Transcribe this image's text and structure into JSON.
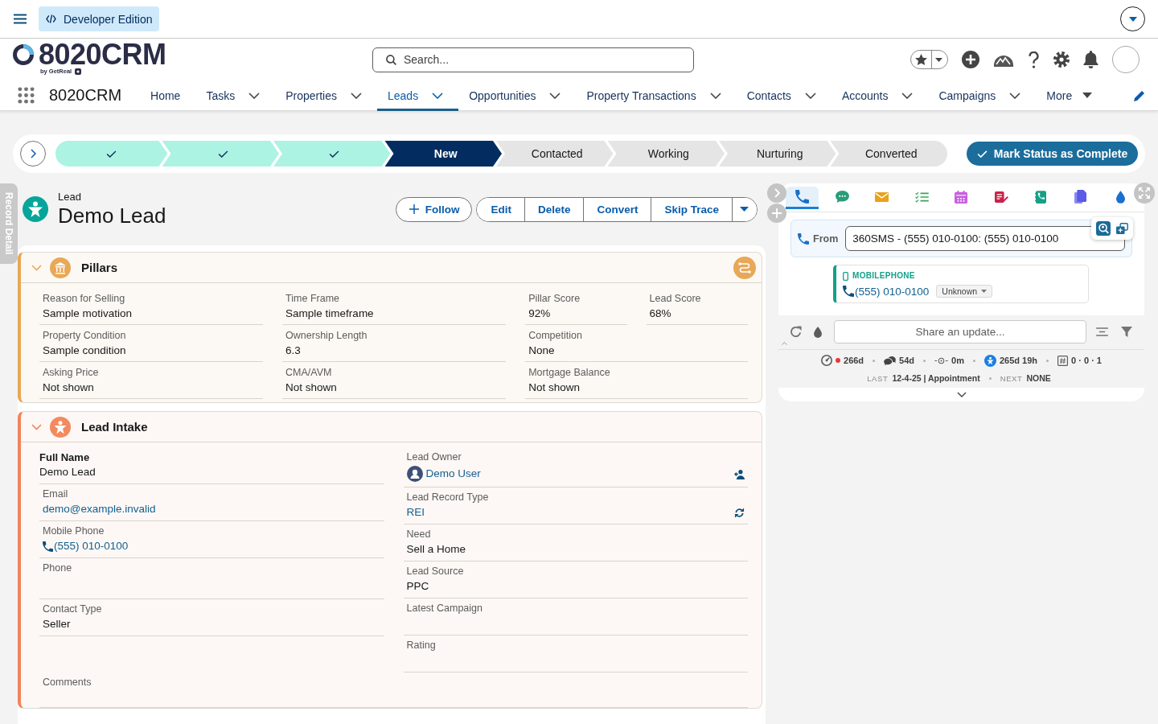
{
  "top_bar": {
    "badge": "Developer Edition"
  },
  "logo": {
    "name": "8020CRM",
    "tagline": "by GetReal"
  },
  "search": {
    "placeholder": "Search..."
  },
  "nav": {
    "app_name": "8020CRM",
    "items": [
      {
        "label": "Home",
        "menu": false,
        "selected": false
      },
      {
        "label": "Tasks",
        "menu": true,
        "selected": false
      },
      {
        "label": "Properties",
        "menu": true,
        "selected": false
      },
      {
        "label": "Leads",
        "menu": true,
        "selected": true
      },
      {
        "label": "Opportunities",
        "menu": true,
        "selected": false
      },
      {
        "label": "Property Transactions",
        "menu": true,
        "selected": false
      },
      {
        "label": "Contacts",
        "menu": true,
        "selected": false
      },
      {
        "label": "Accounts",
        "menu": true,
        "selected": false
      },
      {
        "label": "Campaigns",
        "menu": true,
        "selected": false
      }
    ],
    "more": "More"
  },
  "path": {
    "stages": [
      {
        "complete": true,
        "selected": false
      },
      {
        "complete": true,
        "selected": false
      },
      {
        "complete": true,
        "selected": false
      },
      {
        "label": "New",
        "complete": false,
        "selected": true
      },
      {
        "label": "Contacted",
        "complete": false,
        "selected": false
      },
      {
        "label": "Working",
        "complete": false,
        "selected": false
      },
      {
        "label": "Nurturing",
        "complete": false,
        "selected": false
      },
      {
        "label": "Converted",
        "complete": false,
        "selected": false
      }
    ],
    "action": "Mark Status as Complete"
  },
  "side_tab": "Record Detail",
  "record": {
    "object": "Lead",
    "title": "Demo Lead",
    "follow": "Follow",
    "actions": [
      "Edit",
      "Delete",
      "Convert",
      "Skip Trace"
    ]
  },
  "pillars": {
    "title": "Pillars",
    "expanded": true,
    "rows": [
      [
        {
          "label": "Reason for Selling",
          "value": "Sample motivation"
        },
        {
          "label": "Time Frame",
          "value": "Sample timeframe"
        },
        {
          "label": "Pillar Score",
          "value": "92%"
        },
        {
          "label": "Lead Score",
          "value": "68%"
        }
      ],
      [
        {
          "label": "Property Condition",
          "value": "Sample condition"
        },
        {
          "label": "Ownership Length",
          "value": "6.3"
        },
        {
          "label": "Competition",
          "value": "None"
        }
      ],
      [
        {
          "label": "Asking Price",
          "value": "Not shown"
        },
        {
          "label": "CMA/AVM",
          "value": "Not shown"
        },
        {
          "label": "Mortgage Balance",
          "value": "Not shown"
        }
      ]
    ]
  },
  "lead_intake": {
    "title": "Lead Intake",
    "expanded": true,
    "left": [
      {
        "kind": "name",
        "label": "Full Name",
        "value": "Demo Lead"
      },
      {
        "kind": "email",
        "label": "Email",
        "value": "demo@example.invalid"
      },
      {
        "kind": "phone",
        "label": "Mobile Phone",
        "value": "(555) 010-0100"
      },
      {
        "kind": "text",
        "label": "Phone"
      },
      {
        "kind": "text",
        "label": "Contact Type",
        "value": "Seller"
      }
    ],
    "right": [
      {
        "kind": "owner",
        "label": "Lead Owner",
        "value": "Demo User"
      },
      {
        "kind": "record_type",
        "label": "Lead Record Type",
        "value": "REI"
      },
      {
        "kind": "text",
        "label": "Need",
        "value": "Sell a Home"
      },
      {
        "kind": "text",
        "label": "Lead Source",
        "value": "PPC"
      },
      {
        "kind": "text",
        "label": "Latest Campaign"
      },
      {
        "kind": "text",
        "label": "Rating"
      }
    ],
    "full": [
      {
        "kind": "text",
        "label": "Comments"
      }
    ]
  },
  "activity": {
    "tabs": [
      {
        "kind": "call",
        "selected": true
      },
      {
        "kind": "sms",
        "selected": false
      },
      {
        "kind": "email",
        "selected": false
      },
      {
        "kind": "task",
        "selected": false
      },
      {
        "kind": "event",
        "selected": false
      },
      {
        "kind": "note",
        "selected": false
      },
      {
        "kind": "call_log",
        "selected": false
      },
      {
        "kind": "document",
        "selected": false
      },
      {
        "kind": "drip",
        "selected": false
      }
    ],
    "from": {
      "label": "From",
      "value": "360SMS - (555) 010-0100: (555) 010-0100"
    },
    "recipient": {
      "type": "MOBILEPHONE",
      "phone": "(555) 010-0100",
      "status": "Unknown"
    },
    "share_placeholder": "Share an update...",
    "stats": [
      {
        "kind": "age",
        "value": "266d",
        "alert": true
      },
      {
        "kind": "messages",
        "value": "54d",
        "alert": false
      },
      {
        "kind": "response",
        "value": "0m",
        "alert": false
      },
      {
        "kind": "owner_age",
        "value": "265d 19h",
        "alert": false
      },
      {
        "kind": "counts",
        "value": "0 · 0 · 1",
        "alert": false
      }
    ],
    "last": {
      "label": "LAST",
      "value": "12-4-25 | Appointment"
    },
    "next": {
      "label": "NEXT",
      "value": "NONE"
    }
  }
}
